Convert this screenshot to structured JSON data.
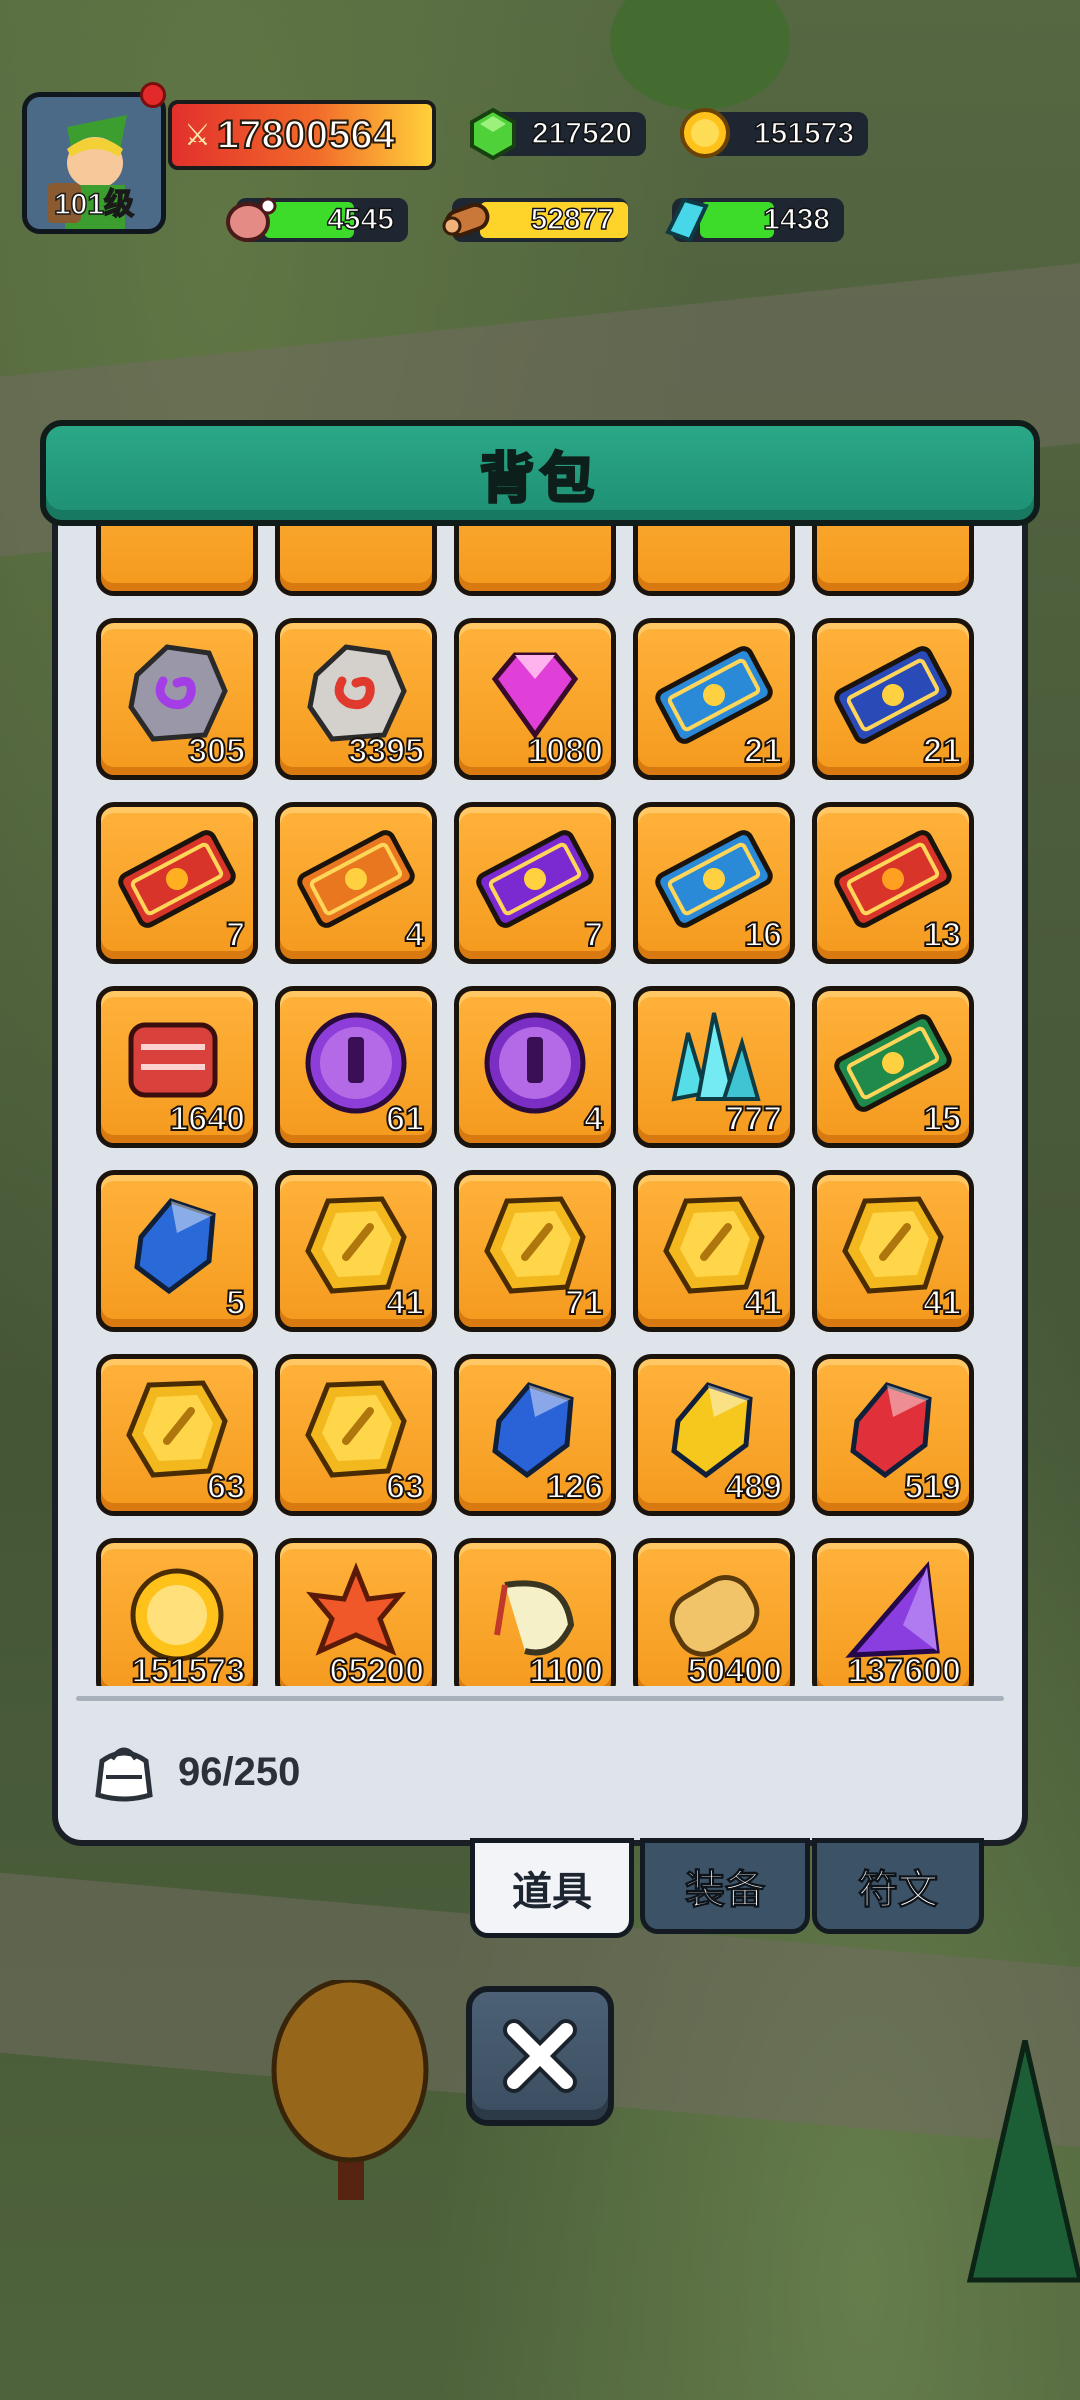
{
  "hud": {
    "player_level": "101级",
    "power": "17800564",
    "resources": [
      {
        "name": "gem",
        "icon": "green-gem-icon",
        "value": "217520"
      },
      {
        "name": "gold",
        "icon": "gold-coin-icon",
        "value": "151573"
      },
      {
        "name": "meat",
        "icon": "meat-icon",
        "value": "4545",
        "bar_color": "#3ddc2b"
      },
      {
        "name": "wood",
        "icon": "wood-log-icon",
        "value": "52877",
        "bar_color": "#ffd42a"
      },
      {
        "name": "crystal",
        "icon": "crystal-icon",
        "value": "1438",
        "bar_color": "#3ddc2b"
      }
    ]
  },
  "panel": {
    "title": "背包",
    "capacity": "96/250"
  },
  "items": [
    {
      "icon": "purple-swirl-stone-icon",
      "qty": "305"
    },
    {
      "icon": "red-swirl-stone-icon",
      "qty": "3395"
    },
    {
      "icon": "pink-diamond-icon",
      "qty": "1080"
    },
    {
      "icon": "blue-egg-ticket-icon",
      "qty": "21"
    },
    {
      "icon": "blue-beast-ticket-icon",
      "qty": "21"
    },
    {
      "icon": "red-drop-ticket-icon",
      "qty": "7"
    },
    {
      "icon": "orange-lightning-ticket-icon",
      "qty": "4"
    },
    {
      "icon": "purple-potion-ticket-icon",
      "qty": "7"
    },
    {
      "icon": "blue-snowflake-ticket-icon",
      "qty": "16"
    },
    {
      "icon": "red-flame-ticket-icon",
      "qty": "13"
    },
    {
      "icon": "meat-slabs-icon",
      "qty": "1640"
    },
    {
      "icon": "purple-sword-orb-icon",
      "qty": "61"
    },
    {
      "icon": "purple-helmet-orb-icon",
      "qty": "4"
    },
    {
      "icon": "cyan-crystal-cluster-icon",
      "qty": "777"
    },
    {
      "icon": "green-scroll-ticket-icon",
      "qty": "15"
    },
    {
      "icon": "blue-snowflake-gem-icon",
      "qty": "5"
    },
    {
      "icon": "gold-leaf-coin-icon",
      "qty": "41"
    },
    {
      "icon": "gold-hat-coin-icon",
      "qty": "71"
    },
    {
      "icon": "gold-sword-coin-icon",
      "qty": "41"
    },
    {
      "icon": "gold-bow-coin-icon",
      "qty": "41"
    },
    {
      "icon": "gold-shield-coin-icon",
      "qty": "63"
    },
    {
      "icon": "gold-wing-coin-icon",
      "qty": "63"
    },
    {
      "icon": "blue-sapphire-icon",
      "qty": "126"
    },
    {
      "icon": "yellow-topaz-icon",
      "qty": "489"
    },
    {
      "icon": "red-ruby-icon",
      "qty": "519"
    },
    {
      "icon": "gold-coin-icon",
      "qty": "151573"
    },
    {
      "icon": "maple-leaf-icon",
      "qty": "65200"
    },
    {
      "icon": "shrimp-icon",
      "qty": "1100"
    },
    {
      "icon": "bread-loaf-icon",
      "qty": "50400"
    },
    {
      "icon": "purple-prism-icon",
      "qty": "137600"
    }
  ],
  "tabs": [
    {
      "label": "道具",
      "active": true
    },
    {
      "label": "装备",
      "active": false
    },
    {
      "label": "符文",
      "active": false
    }
  ],
  "colors": {
    "panel_header": "#1e8f72",
    "cell": "#f49a1e",
    "tab_inactive": "#3c5266",
    "close_button": "#3b4d60"
  }
}
